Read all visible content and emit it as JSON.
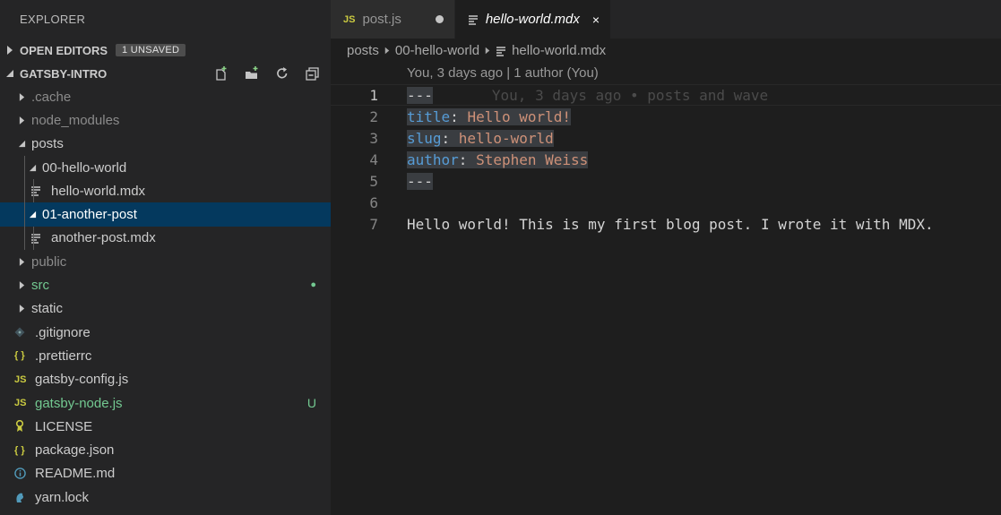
{
  "explorer": {
    "title": "EXPLORER",
    "open_editors": {
      "label": "OPEN EDITORS",
      "badge": "1 UNSAVED"
    },
    "project": {
      "label": "GATSBY-INTRO"
    },
    "tree": [
      {
        "label": ".cache",
        "kind": "folder",
        "depth": 1,
        "expanded": false,
        "dim": true
      },
      {
        "label": "node_modules",
        "kind": "folder",
        "depth": 1,
        "expanded": false,
        "dim": true
      },
      {
        "label": "posts",
        "kind": "folder",
        "depth": 1,
        "expanded": true
      },
      {
        "label": "00-hello-world",
        "kind": "folder",
        "depth": 2,
        "expanded": true
      },
      {
        "label": "hello-world.mdx",
        "kind": "mdx",
        "depth": 3
      },
      {
        "label": "01-another-post",
        "kind": "folder",
        "depth": 2,
        "expanded": true,
        "selected": true
      },
      {
        "label": "another-post.mdx",
        "kind": "mdx",
        "depth": 3
      },
      {
        "label": "public",
        "kind": "folder",
        "depth": 1,
        "expanded": false,
        "dim": true
      },
      {
        "label": "src",
        "kind": "folder",
        "depth": 1,
        "expanded": false,
        "status": "green",
        "decoration": "●"
      },
      {
        "label": "static",
        "kind": "folder",
        "depth": 1,
        "expanded": false
      },
      {
        "label": ".gitignore",
        "kind": "git",
        "depth": 1
      },
      {
        "label": ".prettierrc",
        "kind": "json",
        "depth": 1
      },
      {
        "label": "gatsby-config.js",
        "kind": "js",
        "depth": 1
      },
      {
        "label": "gatsby-node.js",
        "kind": "js",
        "depth": 1,
        "status": "green",
        "decoration": "U"
      },
      {
        "label": "LICENSE",
        "kind": "license",
        "depth": 1
      },
      {
        "label": "package.json",
        "kind": "json",
        "depth": 1
      },
      {
        "label": "README.md",
        "kind": "info",
        "depth": 1
      },
      {
        "label": "yarn.lock",
        "kind": "yarn",
        "depth": 1
      }
    ]
  },
  "tabs": [
    {
      "label": "post.js",
      "icon": "JS",
      "dirty": true,
      "active": false
    },
    {
      "label": "hello-world.mdx",
      "icon": "md-lines",
      "active": true,
      "close": "×"
    }
  ],
  "icons": {
    "js": "JS",
    "json": "{ }"
  },
  "breadcrumb": [
    "posts",
    "00-hello-world",
    "hello-world.mdx"
  ],
  "codelens": "You, 3 days ago | 1 author (You)",
  "editor": {
    "lines": [
      {
        "n": "1",
        "tokens": [
          {
            "t": "---",
            "c": "p",
            "hl": true
          }
        ],
        "blame": "You, 3 days ago • posts and wave",
        "current": true
      },
      {
        "n": "2",
        "tokens": [
          {
            "t": "title",
            "c": "k",
            "hl": true
          },
          {
            "t": ": ",
            "c": "p",
            "hl": true
          },
          {
            "t": "Hello world!",
            "c": "s",
            "hl": true
          }
        ]
      },
      {
        "n": "3",
        "tokens": [
          {
            "t": "slug",
            "c": "k",
            "hl": true
          },
          {
            "t": ": ",
            "c": "p",
            "hl": true
          },
          {
            "t": "hello-world",
            "c": "s",
            "hl": true
          }
        ]
      },
      {
        "n": "4",
        "tokens": [
          {
            "t": "author",
            "c": "k",
            "hl": true
          },
          {
            "t": ": ",
            "c": "p",
            "hl": true
          },
          {
            "t": "Stephen Weiss",
            "c": "s",
            "hl": true
          }
        ]
      },
      {
        "n": "5",
        "tokens": [
          {
            "t": "---",
            "c": "p",
            "hl": true
          }
        ]
      },
      {
        "n": "6",
        "tokens": []
      },
      {
        "n": "7",
        "tokens": [
          {
            "t": "Hello world! This is my first blog post. I wrote it with MDX.",
            "c": "p"
          }
        ]
      }
    ]
  },
  "colors": {
    "accent_selection": "#04395e",
    "git_green": "#73c991",
    "js_yellow": "#cbcb41"
  }
}
